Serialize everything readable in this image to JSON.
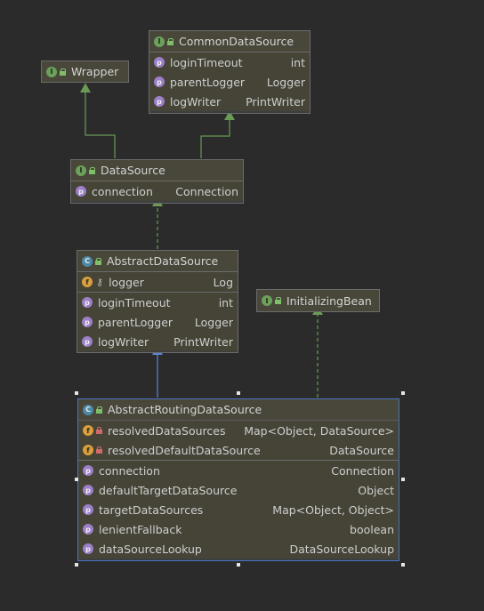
{
  "diagram": {
    "classes": {
      "wrapper": {
        "badge": "I",
        "title": "Wrapper",
        "rows": []
      },
      "common_data_source": {
        "badge": "I",
        "title": "CommonDataSource",
        "rows": [
          {
            "badge": "p",
            "name": "loginTimeout",
            "type": "int"
          },
          {
            "badge": "p",
            "name": "parentLogger",
            "type": "Logger"
          },
          {
            "badge": "p",
            "name": "logWriter",
            "type": "PrintWriter"
          }
        ]
      },
      "data_source": {
        "badge": "I",
        "title": "DataSource",
        "rows": [
          {
            "badge": "p",
            "name": "connection",
            "type": "Connection"
          }
        ]
      },
      "abstract_data_source": {
        "badge": "C",
        "title": "AbstractDataSource",
        "fields": [
          {
            "badge": "f",
            "name": "logger",
            "type": "Log",
            "modifier": "key-icon"
          }
        ],
        "rows": [
          {
            "badge": "p",
            "name": "loginTimeout",
            "type": "int"
          },
          {
            "badge": "p",
            "name": "parentLogger",
            "type": "Logger"
          },
          {
            "badge": "p",
            "name": "logWriter",
            "type": "PrintWriter"
          }
        ]
      },
      "initializing_bean": {
        "badge": "I",
        "title": "InitializingBean",
        "rows": []
      },
      "abstract_routing_data_source": {
        "badge": "C",
        "title": "AbstractRoutingDataSource",
        "fields": [
          {
            "badge": "f",
            "name": "resolvedDataSources",
            "type": "Map<Object, DataSource>",
            "modifier": "lock-icon"
          },
          {
            "badge": "f",
            "name": "resolvedDefaultDataSource",
            "type": "DataSource",
            "modifier": "lock-icon"
          }
        ],
        "rows": [
          {
            "badge": "p",
            "name": "connection",
            "type": "Connection"
          },
          {
            "badge": "p",
            "name": "defaultTargetDataSource",
            "type": "Object"
          },
          {
            "badge": "p",
            "name": "targetDataSources",
            "type": "Map<Object, Object>"
          },
          {
            "badge": "p",
            "name": "lenientFallback",
            "type": "boolean"
          },
          {
            "badge": "p",
            "name": "dataSourceLookup",
            "type": "DataSourceLookup"
          }
        ]
      }
    },
    "colors": {
      "background": "#2b2b2b",
      "interface_arrow": "#6a9a55",
      "extends_arrow": "#5b86d6",
      "selection_border": "#4b74c2"
    }
  }
}
